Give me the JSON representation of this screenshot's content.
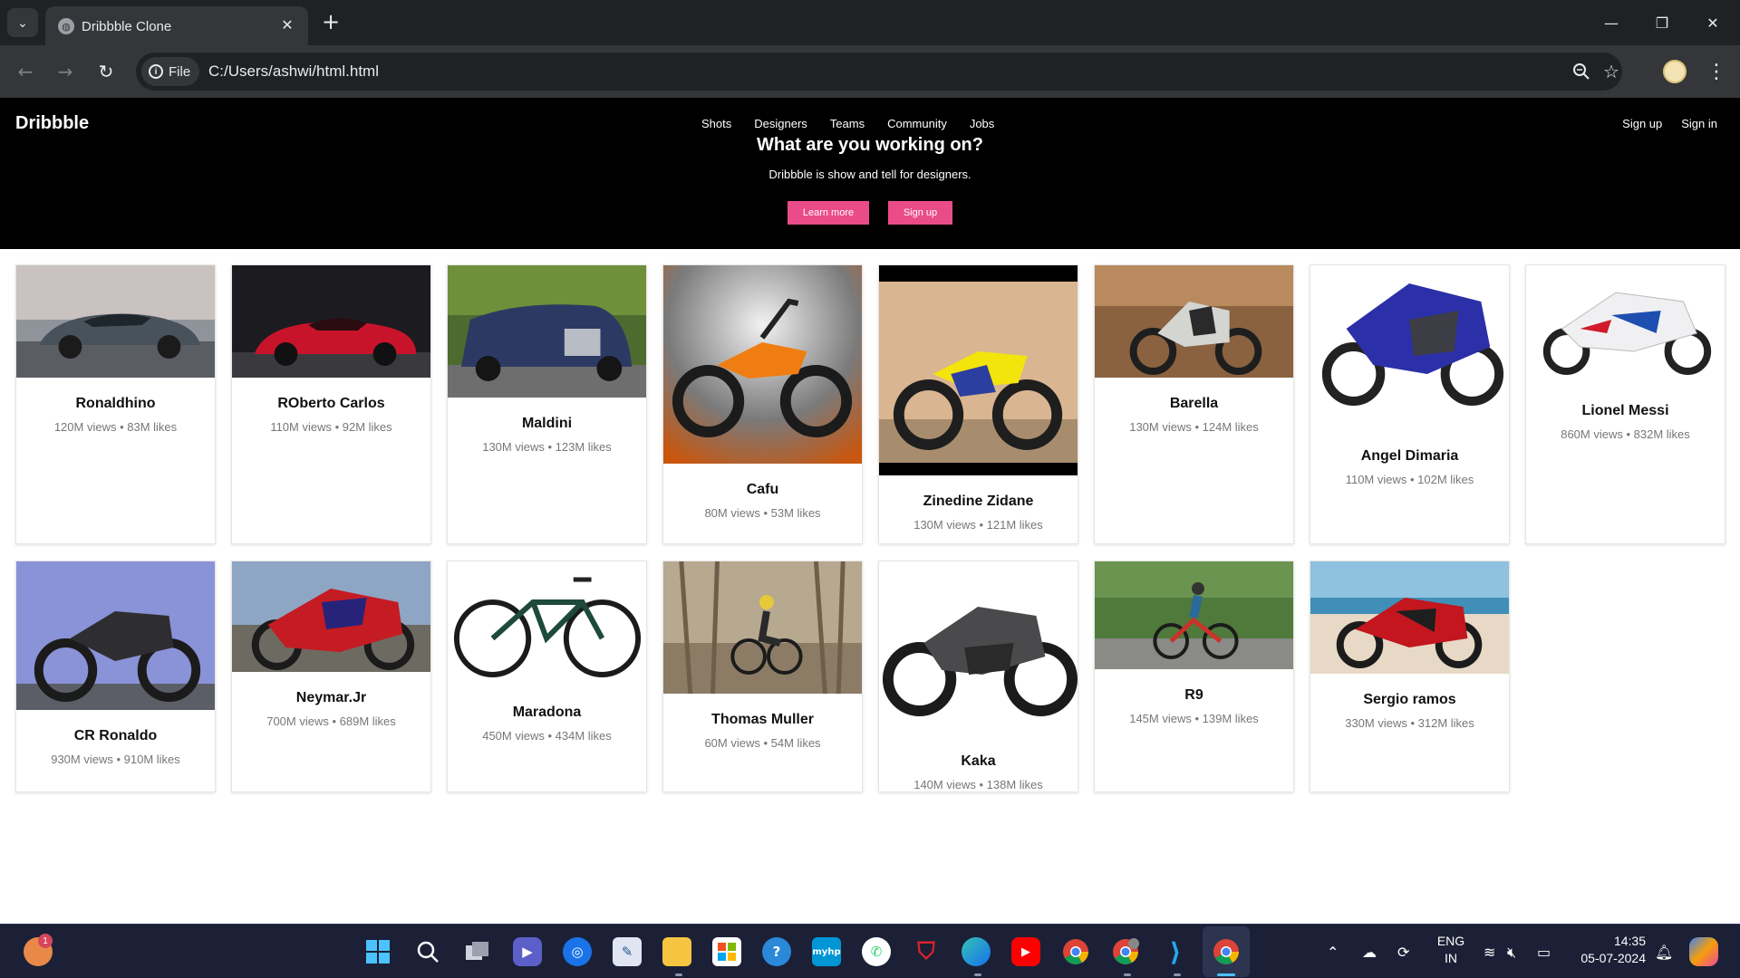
{
  "browser": {
    "tab_title": "Dribbble Clone",
    "address_chip": "File",
    "url": "C:/Users/ashwi/html.html"
  },
  "site": {
    "logo": "Dribbble",
    "nav": [
      "Shots",
      "Designers",
      "Teams",
      "Community",
      "Jobs"
    ],
    "auth": [
      "Sign up",
      "Sign in"
    ],
    "hero_title": "What are you working on?",
    "hero_subtitle": "Dribbble is show and tell for designers.",
    "cta_primary": "Learn more",
    "cta_secondary": "Sign up",
    "accent_color": "#ea4c89"
  },
  "cards": [
    {
      "name": "Ronaldhino",
      "stats": "120M views • 83M likes",
      "image": "grey-supercar"
    },
    {
      "name": "ROberto Carlos",
      "stats": "110M views • 92M likes",
      "image": "red-sports-car"
    },
    {
      "name": "Maldini",
      "stats": "130M views • 123M likes",
      "image": "blue-luxury-sedan"
    },
    {
      "name": "Cafu",
      "stats": "80M views • 53M likes",
      "image": "orange-dirt-bike"
    },
    {
      "name": "Zinedine Zidane",
      "stats": "130M views • 121M likes",
      "image": "yellow-mini-dirt-bike"
    },
    {
      "name": "Barella",
      "stats": "130M views • 124M likes",
      "image": "electric-motorcycle"
    },
    {
      "name": "Angel Dimaria",
      "stats": "110M views • 102M likes",
      "image": "blue-sport-motorcycle"
    },
    {
      "name": "Lionel Messi",
      "stats": "860M views • 832M likes",
      "image": "white-superbike"
    },
    {
      "name": "CR Ronaldo",
      "stats": "930M views • 910M likes",
      "image": "black-roadster-motorcycle"
    },
    {
      "name": "Neymar.Jr",
      "stats": "700M views • 689M likes",
      "image": "red-sport-motorcycle"
    },
    {
      "name": "Maradona",
      "stats": "450M views • 434M likes",
      "image": "mountain-bicycle"
    },
    {
      "name": "Thomas Muller",
      "stats": "60M views • 54M likes",
      "image": "forest-cyclist"
    },
    {
      "name": "Kaka",
      "stats": "140M views • 138M likes",
      "image": "grey-naked-motorcycle"
    },
    {
      "name": "R9",
      "stats": "145M views • 139M likes",
      "image": "road-cyclist"
    },
    {
      "name": "Sergio ramos",
      "stats": "330M views • 312M likes",
      "image": "red-beach-motorcycle"
    }
  ],
  "taskbar": {
    "notification_count": "1",
    "language_line1": "ENG",
    "language_line2": "IN",
    "time": "14:35",
    "date": "05-07-2024",
    "apps": [
      "windows-start",
      "search",
      "task-view",
      "teams-meet",
      "support-assist",
      "notepad",
      "file-explorer",
      "microsoft-store",
      "quick-assist",
      "myhp",
      "whatsapp",
      "mcafee",
      "edge",
      "youtube",
      "chrome",
      "chrome-profile",
      "vscode",
      "chrome-active"
    ],
    "tray_icons": [
      "chevron-up",
      "onedrive-error",
      "sync",
      "wifi",
      "volume-muted",
      "battery",
      "notification-bell",
      "copilot"
    ]
  }
}
